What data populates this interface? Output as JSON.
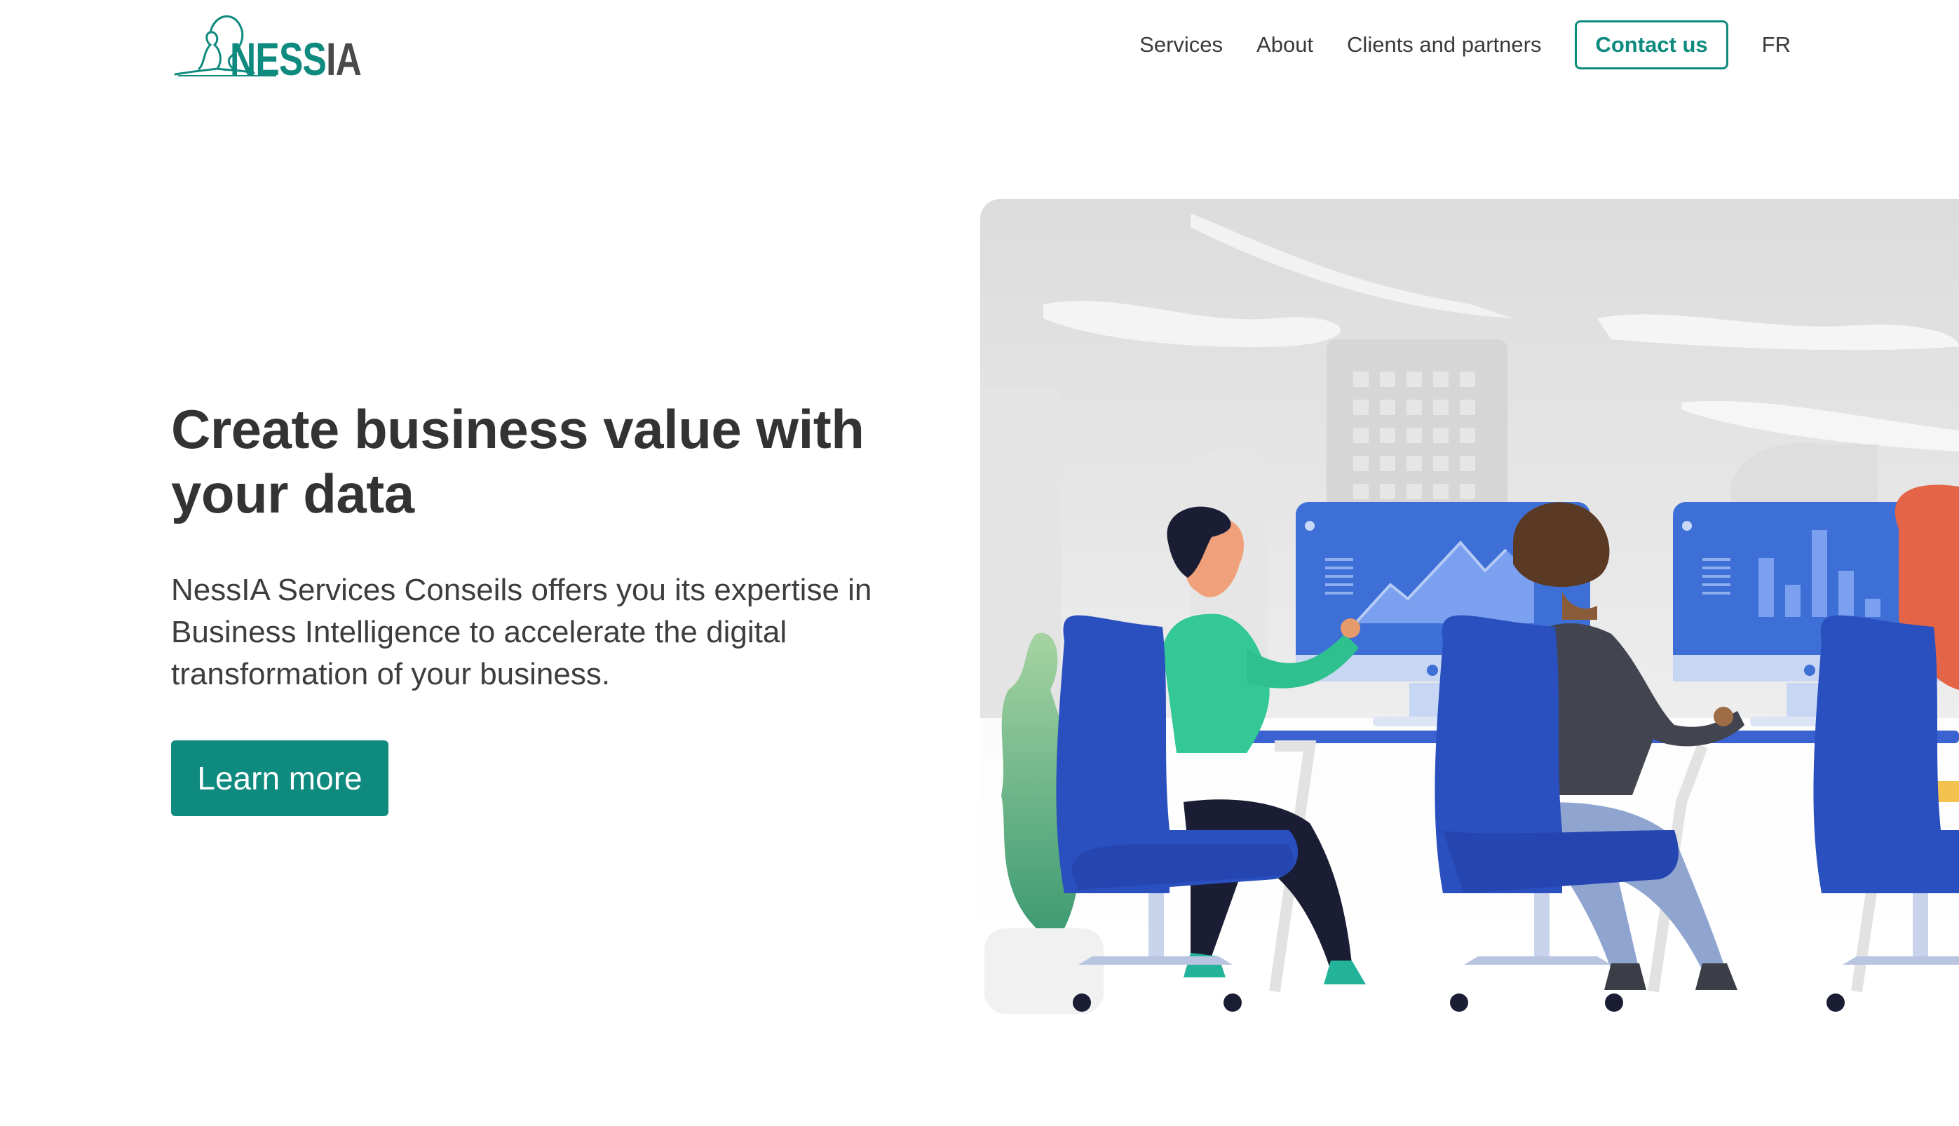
{
  "header": {
    "logo": {
      "text_part1": "NESS",
      "text_part2": "IA"
    },
    "nav": {
      "services": "Services",
      "about": "About",
      "clients": "Clients and partners",
      "contact": "Contact us",
      "lang": "FR"
    }
  },
  "hero": {
    "title": "Create business value with your data",
    "description": "NessIA Services Conseils offers you its expertise in Business Intelligence to accelerate the digital transformation of your business.",
    "cta": "Learn more"
  },
  "colors": {
    "brand": "#0f8a7e",
    "text": "#333333",
    "chair": "#2a4fbf",
    "monitor": "#3d6fd6"
  },
  "illustration": {
    "subject": "people-at-desks-analytics",
    "icons": [
      "line-chart-icon",
      "bar-chart-icon",
      "plant-icon",
      "building-icon"
    ]
  }
}
